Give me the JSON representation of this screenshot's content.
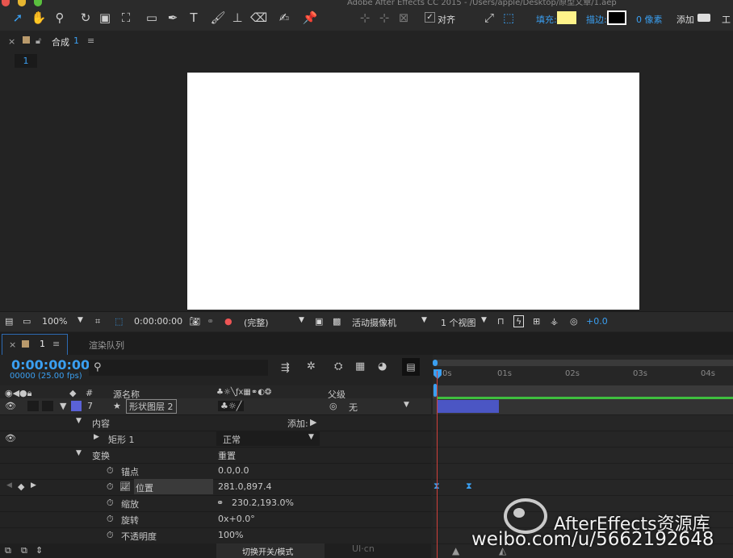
{
  "window": {
    "title": "Adobe After Effects CC 2015 - /Users/apple/Desktop/原型文章/1.aep"
  },
  "toolbar": {
    "align_label": "对齐",
    "fill_label": "填充:",
    "stroke_label": "描边:",
    "stroke_width": "0 像素",
    "add_label": "添加",
    "workspace_label": "工",
    "fill_color": "#fff38a",
    "stroke_color": "#000000",
    "accent": "#3a9ff1"
  },
  "comp_panel": {
    "tab_title": "合成",
    "tab_number": "1",
    "flow_badge": "1"
  },
  "viewer_bar": {
    "zoom": "100%",
    "timecode": "0:00:00:00",
    "resolution": "(完整)",
    "camera": "活动摄像机",
    "views": "1 个视图",
    "exposure": "+0.0"
  },
  "timeline": {
    "tab_comp": "1",
    "tab_render": "渲染队列",
    "timecode": "0:00:00:00",
    "frames": "00000 (25.00 fps)",
    "col_number": "#",
    "col_source": "源名称",
    "col_parent": "父级",
    "ruler": [
      "0s",
      "01s",
      "02s",
      "03s",
      "04s"
    ],
    "layer": {
      "number": "7",
      "name": "形状图层 2",
      "parent": "无"
    },
    "contents_label": "内容",
    "add_label": "添加:",
    "rect_label": "矩形 1",
    "blend_mode": "正常",
    "transform_label": "变换",
    "reset_label": "重置",
    "props": [
      {
        "name": "锚点",
        "value": "0.0,0.0"
      },
      {
        "name": "位置",
        "value": "281.0,897.4"
      },
      {
        "name": "缩放",
        "value": "230.2,193.0%"
      },
      {
        "name": "旋转",
        "value": "0x+0.0°"
      },
      {
        "name": "不透明度",
        "value": "100%"
      }
    ],
    "footer_toggle": "切换开关/模式"
  },
  "watermark": {
    "brand": "AfterEffects资源库",
    "url": "weibo.com/u/5662192648",
    "tiny": "UI·cn"
  }
}
